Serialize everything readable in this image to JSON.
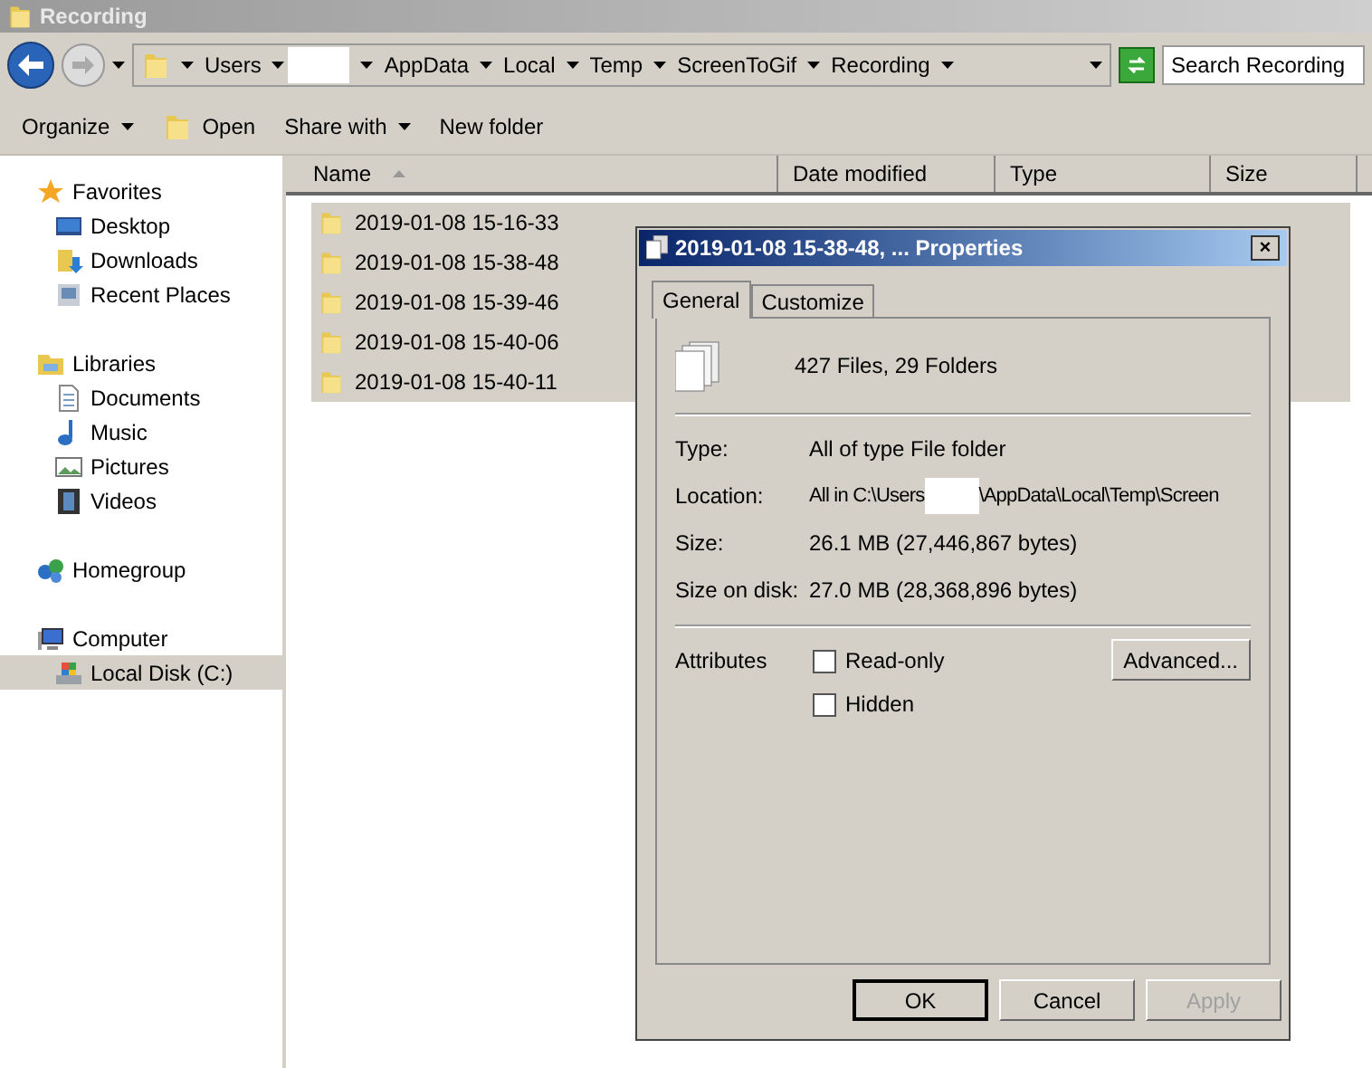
{
  "window": {
    "title": "Recording"
  },
  "address_bar": {
    "crumbs": [
      {
        "kind": "crumb",
        "label": "Users"
      },
      {
        "kind": "redacted"
      },
      {
        "kind": "crumb",
        "label": "AppData"
      },
      {
        "kind": "crumb",
        "label": "Local"
      },
      {
        "kind": "crumb",
        "label": "Temp"
      },
      {
        "kind": "crumb",
        "label": "ScreenToGif"
      },
      {
        "kind": "crumb",
        "label": "Recording"
      }
    ],
    "search_placeholder": "Search Recording"
  },
  "toolbar": [
    {
      "label": "Organize",
      "kind": "menu"
    },
    {
      "label": "Open",
      "kind": "open"
    },
    {
      "label": "Share with",
      "kind": "menu"
    },
    {
      "label": "New folder",
      "kind": "plain"
    }
  ],
  "sidebar": {
    "groups": [
      {
        "label": "Favorites",
        "kind": "star",
        "children": [
          {
            "label": "Desktop",
            "kind": "desktop",
            "selected": false
          },
          {
            "label": "Downloads",
            "kind": "downloads",
            "selected": false
          },
          {
            "label": "Recent Places",
            "kind": "recent",
            "selected": false
          }
        ]
      },
      {
        "label": "Libraries",
        "kind": "libraries",
        "children": [
          {
            "label": "Documents",
            "kind": "document",
            "selected": false
          },
          {
            "label": "Music",
            "kind": "music",
            "selected": false
          },
          {
            "label": "Pictures",
            "kind": "pictures",
            "selected": false
          },
          {
            "label": "Videos",
            "kind": "videos",
            "selected": false
          }
        ]
      },
      {
        "label": "Homegroup",
        "kind": "homegroup"
      },
      {
        "label": "Computer",
        "kind": "computer",
        "children": [
          {
            "label": "Local Disk (C:)",
            "kind": "disk",
            "selected": true
          }
        ]
      }
    ]
  },
  "table": {
    "columns": [
      "Name",
      "Date modified",
      "Type",
      "Size"
    ],
    "rows": [
      {
        "name": "2019-01-08 15-16-33",
        "selected": true
      },
      {
        "name": "2019-01-08 15-38-48",
        "selected": true
      },
      {
        "name": "2019-01-08 15-39-46",
        "selected": true
      },
      {
        "name": "2019-01-08 15-40-06",
        "selected": true
      },
      {
        "name": "2019-01-08 15-40-11",
        "selected": true
      }
    ]
  },
  "dialog": {
    "title": "2019-01-08 15-38-48, ... Properties",
    "close": "×",
    "tabs": [
      {
        "label": "General",
        "selected": true
      },
      {
        "label": "Customize",
        "selected": false
      }
    ],
    "summary": "427 Files, 29 Folders",
    "properties": [
      {
        "label": "Type:",
        "value": "All of type File folder",
        "kind": "plain"
      },
      {
        "label": "Location:",
        "value": "All in C:\\Users",
        "value_after": "\\AppData\\Local\\Temp\\Screen",
        "kind": "redacted"
      },
      {
        "label": "Size:",
        "value": "26.1 MB (27,446,867 bytes)",
        "kind": "plain"
      },
      {
        "label": "Size on disk:",
        "value": "27.0 MB (28,368,896 bytes)",
        "kind": "plain"
      }
    ],
    "attributes_label": "Attributes",
    "attributes": [
      {
        "label": "Read-only",
        "checked": false
      },
      {
        "label": "Hidden",
        "checked": false
      }
    ],
    "advanced_button": "Advanced...",
    "buttons": [
      {
        "label": "OK",
        "disabled": false,
        "default": true
      },
      {
        "label": "Cancel",
        "disabled": false,
        "default": false
      },
      {
        "label": "Apply",
        "disabled": true,
        "default": false
      }
    ]
  }
}
